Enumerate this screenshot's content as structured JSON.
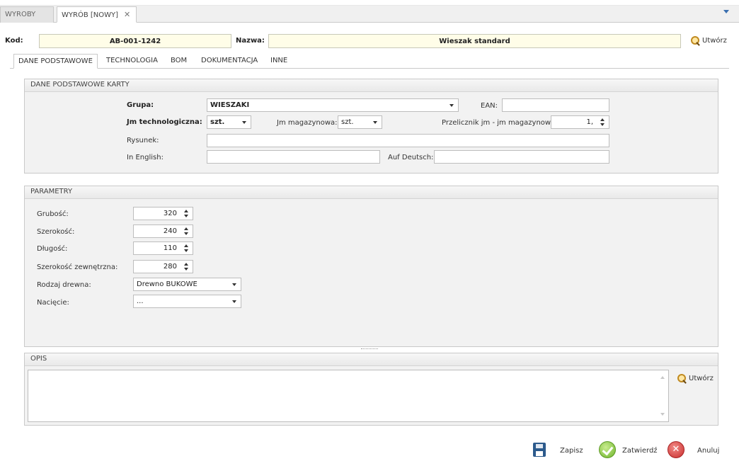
{
  "tabs": [
    {
      "label": "WYROBY"
    },
    {
      "label": "WYRÓB [NOWY]"
    }
  ],
  "header": {
    "kod_label": "Kod:",
    "kod_value": "AB-001-1242",
    "nazwa_label": "Nazwa:",
    "nazwa_value": "Wieszak standard",
    "utworz_label": "Utwórz"
  },
  "subtabs": [
    {
      "label": "DANE PODSTAWOWE"
    },
    {
      "label": "TECHNOLOGIA"
    },
    {
      "label": "BOM"
    },
    {
      "label": "DOKUMENTACJA"
    },
    {
      "label": "INNE"
    }
  ],
  "dane": {
    "title": "DANE PODSTAWOWE KARTY",
    "grupa_label": "Grupa:",
    "grupa_value": "WIESZAKI",
    "ean_label": "EAN:",
    "ean_value": "",
    "jmt_label": "Jm technologiczna:",
    "jmt_value": "szt.",
    "jmm_label": "Jm magazynowa:",
    "jmm_value": "szt.",
    "przel_label": "Przelicznik jm - jm magazynowa:",
    "przel_value": "1,",
    "rysunek_label": "Rysunek:",
    "rysunek_value": "",
    "english_label": "In English:",
    "english_value": "",
    "deutsch_label": "Auf Deutsch:",
    "deutsch_value": ""
  },
  "parametry": {
    "title": "PARAMETRY",
    "grubosc_label": "Grubość:",
    "grubosc_value": "320",
    "szerokosc_label": "Szerokość:",
    "szerokosc_value": "240",
    "dlugosc_label": "Długość:",
    "dlugosc_value": "110",
    "szerzew_label": "Szerokość zewnętrzna:",
    "szerzew_value": "280",
    "drewno_label": "Rodzaj drewna:",
    "drewno_value": "Drewno BUKOWE",
    "naciecie_label": "Nacięcie:",
    "naciecie_value": "..."
  },
  "opis": {
    "title": "OPIS",
    "value": "",
    "utworz_label": "Utwórz"
  },
  "actions": {
    "zapisz": "Zapisz",
    "zatwierdz": "Zatwierdź",
    "anuluj": "Anuluj"
  }
}
